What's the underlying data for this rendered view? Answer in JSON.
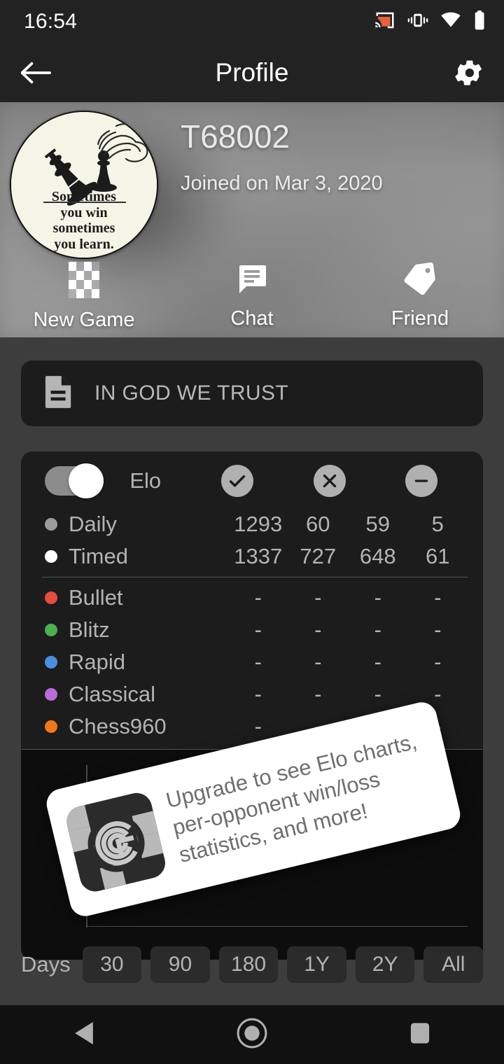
{
  "status_bar": {
    "time": "16:54",
    "icons": [
      "cast-icon",
      "vibrate-icon",
      "wifi-icon",
      "battery-icon"
    ],
    "cast_color": "#e8603c"
  },
  "app_bar": {
    "back_label": "back-arrow-icon",
    "title": "Profile",
    "settings_label": "gear-icon"
  },
  "profile": {
    "username": "T68002",
    "joined": "Joined on Mar 3, 2020",
    "avatar": {
      "alt": "chess-avatar",
      "quote_lines": [
        "Sometimes",
        "you win",
        "sometimes",
        "you learn."
      ]
    },
    "actions": [
      {
        "icon": "chessboard-icon",
        "label": "New Game"
      },
      {
        "icon": "chat-bubble-icon",
        "label": "Chat"
      },
      {
        "icon": "tag-icon",
        "label": "Friend"
      }
    ]
  },
  "status_card": {
    "icon": "note-document-icon",
    "text": "IN GOD WE TRUST"
  },
  "stats": {
    "toggle": {
      "name": "elo-toggle",
      "state": "on"
    },
    "columns": [
      {
        "key": "elo",
        "label": "Elo",
        "icon": null
      },
      {
        "key": "wins",
        "label": "",
        "icon": "check-circle-icon"
      },
      {
        "key": "losses",
        "label": "",
        "icon": "x-circle-icon"
      },
      {
        "key": "draws",
        "label": "",
        "icon": "minus-circle-icon"
      }
    ],
    "rows": [
      {
        "label": "Daily",
        "color": "#9b9b9b",
        "values": [
          "1293",
          "60",
          "59",
          "5"
        ]
      },
      {
        "label": "Timed",
        "color": "#ffffff",
        "values": [
          "1337",
          "727",
          "648",
          "61"
        ]
      },
      {
        "label": "Bullet",
        "color": "#e74c3c",
        "values": [
          "-",
          "-",
          "-",
          "-"
        ]
      },
      {
        "label": "Blitz",
        "color": "#4caf50",
        "values": [
          "-",
          "-",
          "-",
          "-"
        ]
      },
      {
        "label": "Rapid",
        "color": "#4a90e2",
        "values": [
          "-",
          "-",
          "-",
          "-"
        ]
      },
      {
        "label": "Classical",
        "color": "#bb6bd9",
        "values": [
          "-",
          "-",
          "-",
          "-"
        ]
      },
      {
        "label": "Chess960",
        "color": "#f07818",
        "values": [
          "-",
          "-",
          "-",
          "-"
        ]
      }
    ]
  },
  "chart_data": {
    "type": "line",
    "title": "",
    "xlabel": "",
    "ylabel": "",
    "series": [],
    "x": [],
    "grid": false,
    "legend": "none",
    "locked": true,
    "locked_message": "Upgrade to see Elo charts, per-opponent win/loss statistics, and more!"
  },
  "ranges": {
    "label": "Days",
    "buttons": [
      "30",
      "90",
      "180",
      "1Y",
      "2Y",
      "All"
    ]
  },
  "banner": {
    "logo": "app-logo-icon",
    "lines": [
      "Upgrade to see Elo charts,",
      "per-opponent win/loss",
      "statistics, and more!"
    ]
  },
  "nav_bar": {
    "items": [
      "back-triangle-icon",
      "home-circle-icon",
      "recents-square-icon"
    ]
  }
}
